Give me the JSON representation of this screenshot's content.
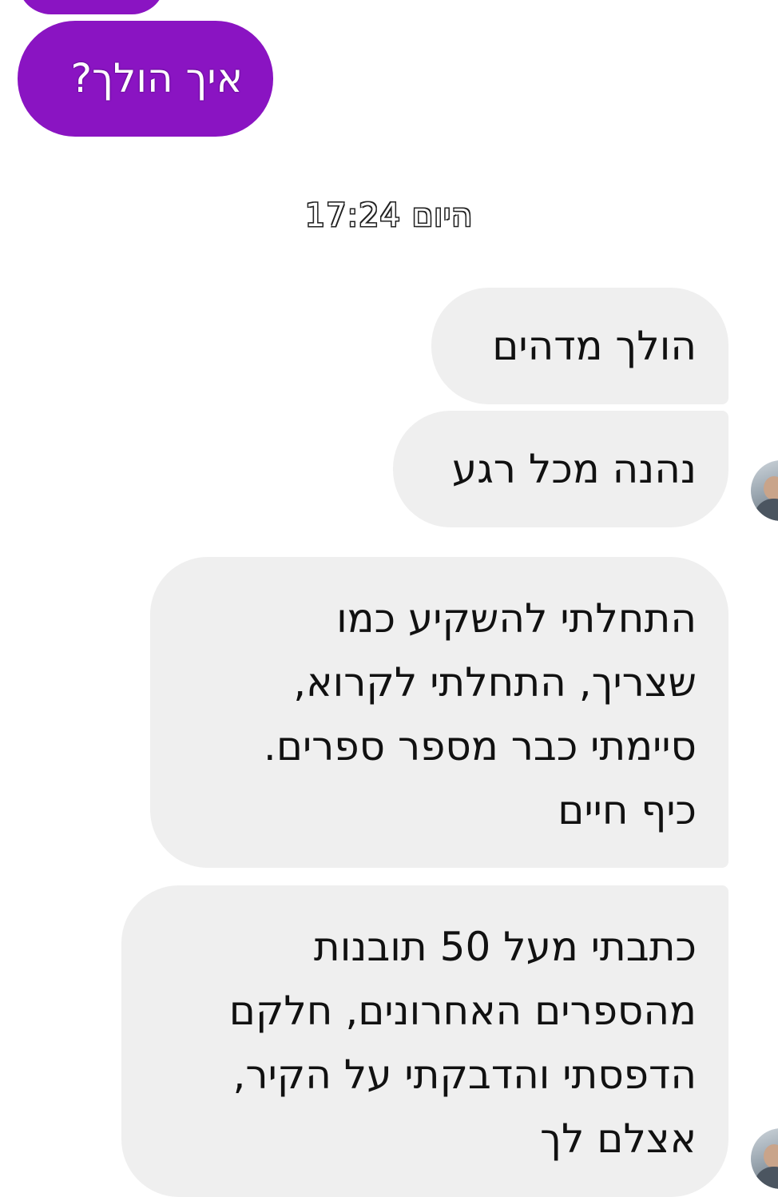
{
  "conversation": {
    "messages": [
      {
        "direction": "outgoing",
        "text": "איך הולך?"
      },
      {
        "direction": "incoming",
        "text": "הולך מדהים"
      },
      {
        "direction": "incoming",
        "text": "נהנה מכל רגע"
      },
      {
        "direction": "incoming",
        "text": "התחלתי להשקיע כמו\nשצריך, התחלתי לקרוא,\nסיימתי כבר מספר ספרים.\nכיף חיים"
      },
      {
        "direction": "incoming",
        "text": "כתבתי מעל 50 תובנות\nמהספרים האחרונים, חלקם\nהדפסתי והדבקתי על הקיר,\nאצלם לך"
      }
    ],
    "timestamp": "היום 17:24"
  },
  "colors": {
    "outgoing_bubble": "#8a14c2",
    "incoming_bubble": "#efefef",
    "background": "#ffffff"
  },
  "icons": {
    "sender_avatar": "avatar-photo"
  }
}
